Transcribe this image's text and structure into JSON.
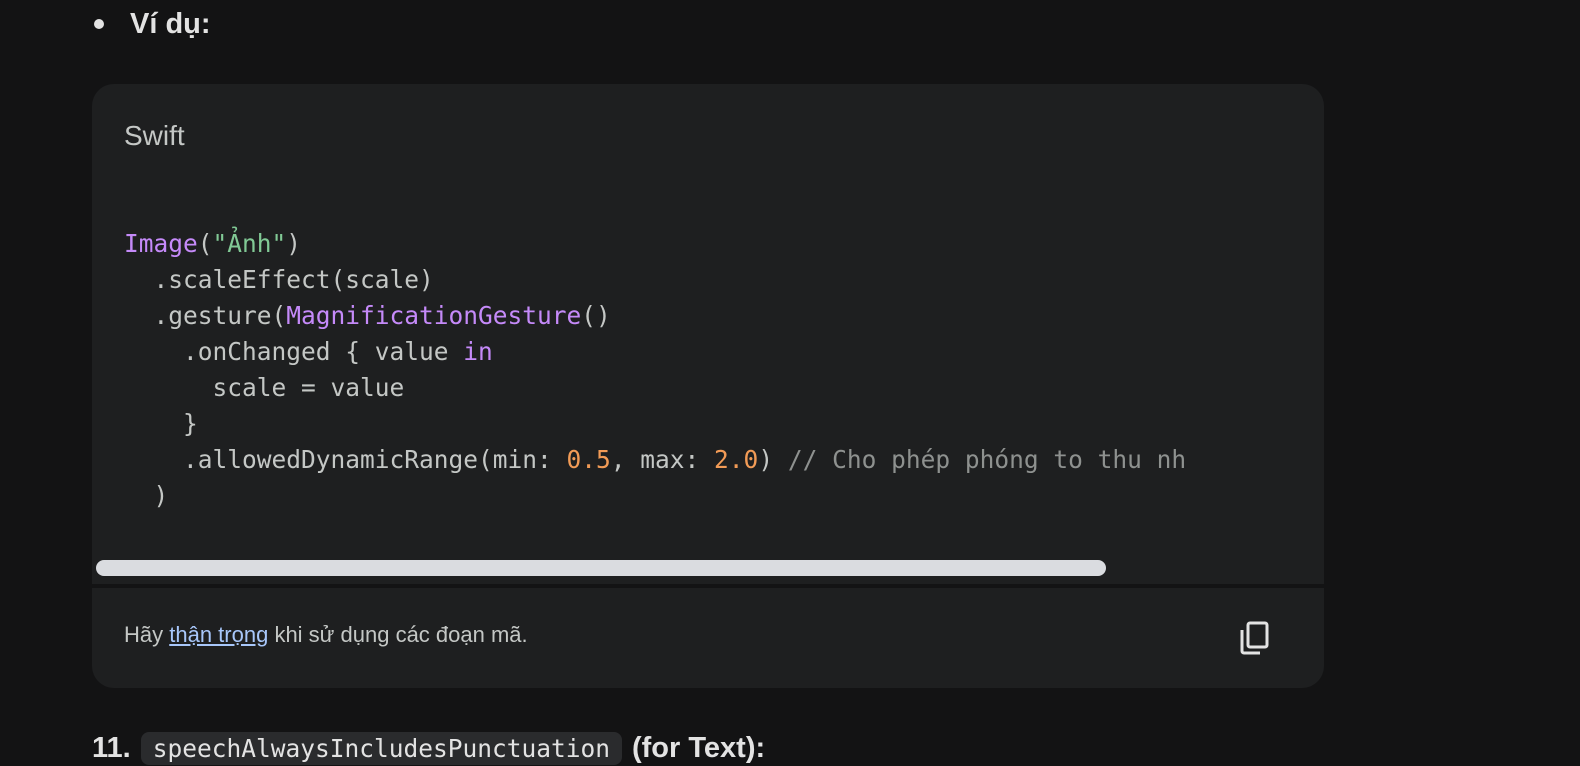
{
  "bullet": {
    "label": "Ví dụ:"
  },
  "code_block": {
    "language": "Swift",
    "lines": [
      [
        {
          "t": "type",
          "v": "Image"
        },
        {
          "t": "plain",
          "v": "("
        },
        {
          "t": "str",
          "v": "\"Ảnh\""
        },
        {
          "t": "plain",
          "v": ")"
        }
      ],
      [
        {
          "t": "plain",
          "v": "  .scaleEffect(scale)"
        }
      ],
      [
        {
          "t": "plain",
          "v": "  .gesture("
        },
        {
          "t": "type",
          "v": "MagnificationGesture"
        },
        {
          "t": "plain",
          "v": "()"
        }
      ],
      [
        {
          "t": "plain",
          "v": "    .onChanged { value "
        },
        {
          "t": "type",
          "v": "in"
        }
      ],
      [
        {
          "t": "plain",
          "v": "      scale = value"
        }
      ],
      [
        {
          "t": "plain",
          "v": "    }"
        }
      ],
      [
        {
          "t": "plain",
          "v": "    .allowedDynamicRange(min: "
        },
        {
          "t": "num",
          "v": "0.5"
        },
        {
          "t": "plain",
          "v": ", max: "
        },
        {
          "t": "num",
          "v": "2.0"
        },
        {
          "t": "plain",
          "v": ") "
        },
        {
          "t": "cmt",
          "v": "// Cho phép phóng to thu nh"
        }
      ],
      [
        {
          "t": "plain",
          "v": "  )"
        }
      ]
    ],
    "scroll_position": 0.0
  },
  "footer": {
    "prefix": "Hãy ",
    "link_text": "thận trọng",
    "suffix": " khi sử dụng các đoạn mã.",
    "copy_icon": "copy-icon"
  },
  "next_heading": {
    "number": "11.",
    "code": "speechAlwaysIncludesPunctuation",
    "suffix": "(for Text):"
  },
  "colors": {
    "background": "#131314",
    "code_background": "#1e1f20",
    "keyword": "#c58af9",
    "string": "#81c995",
    "number": "#f29b56",
    "comment": "#8e918f",
    "link": "#a8c7fa"
  }
}
